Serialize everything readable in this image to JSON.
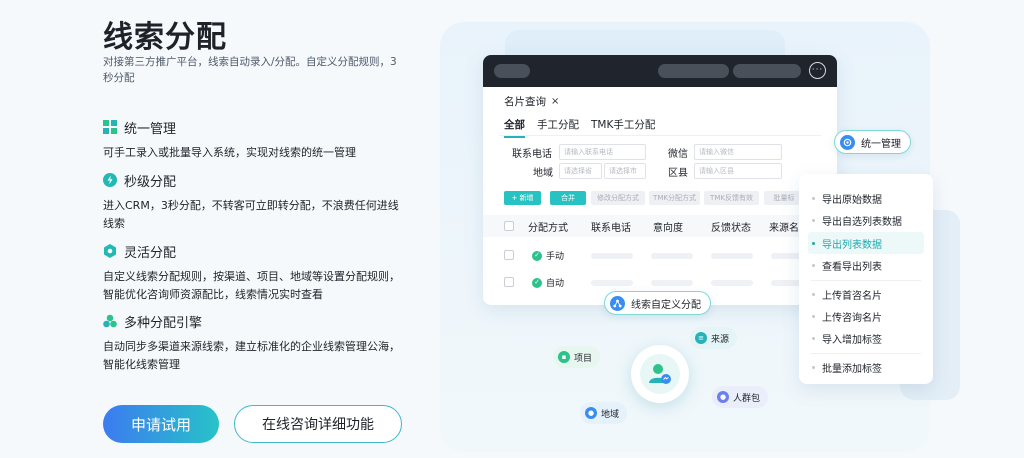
{
  "header": {
    "title": "线索分配",
    "subtitle": "对接第三方推广平台，线索自动录入/分配。自定义分配规则，3秒分配"
  },
  "features": [
    {
      "icon": "grid-icon",
      "title": "统一管理",
      "desc": "可手工录入或批量导入系统，实现对线索的统一管理"
    },
    {
      "icon": "lightning-icon",
      "title": "秒级分配",
      "desc": "进入CRM，3秒分配，不转客可立即转分配，不浪费任何进线线索"
    },
    {
      "icon": "hexagon-icon",
      "title": "灵活分配",
      "desc": "自定义线索分配规则，按渠道、项目、地域等设置分配规则，智能优化咨询师资源配比，线索情况实时查看"
    },
    {
      "icon": "cluster-icon",
      "title": "多种分配引擎",
      "desc": "自动同步多渠道来源线索，建立标准化的企业线索管理公海，智能化线索管理"
    }
  ],
  "actions": {
    "primary": "申请试用",
    "secondary": "在线咨询详细功能"
  },
  "window": {
    "more_label": "···",
    "tab_title": "名片查询",
    "tab_close": "×",
    "sub_tabs": [
      "全部",
      "手工分配",
      "TMK手工分配"
    ],
    "fields": {
      "phone_label": "联系电话",
      "phone_placeholder": "请输入联系电话",
      "wechat_label": "微信",
      "wechat_placeholder": "请输入微信",
      "region_label": "地域",
      "province_placeholder": "请选择省",
      "city_placeholder": "请选择市",
      "district_label": "区县",
      "district_placeholder": "请输入区县"
    },
    "toolbar": [
      "+ 新增",
      "合并",
      "修改分配方式",
      "TMK分配方式",
      "TMK反馈有效",
      "批量标"
    ],
    "table": {
      "headers": [
        "分配方式",
        "联系电话",
        "意向度",
        "反馈状态",
        "来源名"
      ],
      "rows": [
        {
          "method": "手动"
        },
        {
          "method": "自动"
        }
      ]
    }
  },
  "badges": {
    "unified": "统一管理",
    "custom_rule": "线索自定义分配"
  },
  "menu": {
    "items": [
      "导出原始数据",
      "导出自选列表数据",
      "导出列表数据",
      "查看导出列表",
      "上传首咨名片",
      "上传咨询名片",
      "导入增加标签",
      "批量添加标签"
    ],
    "active_index": 2
  },
  "hub_chips": {
    "project": "项目",
    "source": "来源",
    "region": "地域",
    "crowd": "人群包"
  },
  "colors": {
    "accent_teal": "#25b2b8",
    "primary_gradient_start": "#3c7bf0",
    "primary_gradient_end": "#27c3c8",
    "success_green": "#2cc28c"
  }
}
